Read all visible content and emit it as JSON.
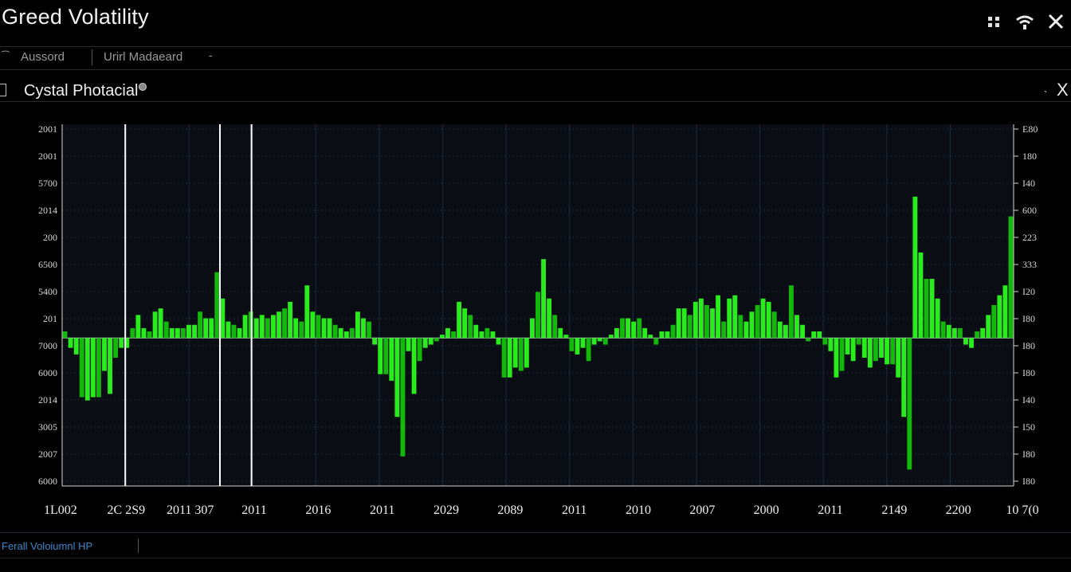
{
  "window": {
    "title": "Greed Volatility",
    "controls": [
      "grid-icon",
      "wifi-icon",
      "close-icon"
    ]
  },
  "tabs": {
    "items": [
      {
        "label": "Aussord"
      },
      {
        "label": "Urirl Madaeard"
      }
    ]
  },
  "panel": {
    "title": "Cystal Photacial"
  },
  "status": {
    "text": "Ferall Voloiumnl HP"
  },
  "colors": {
    "background": "#000000",
    "plot_bg": "#0a0d14",
    "bar": "#2aeb1e",
    "bar_dark": "#14b80c",
    "axis": "#d8d8d8",
    "grid": "#1d2a3a",
    "marker": "#ffffff",
    "status_text": "#3d86c8"
  },
  "chart_data": {
    "type": "bar",
    "title": "",
    "xlabel": "",
    "ylabel": "",
    "baseline": 0,
    "ylim": [
      -4.5,
      6.5
    ],
    "grid": true,
    "y_left_ticks": [
      "2001",
      "2001",
      "5700",
      "2014",
      "200",
      "6500",
      "5400",
      "201",
      "7000",
      "6000",
      "2014",
      "3005",
      "2007",
      "6000"
    ],
    "y_right_ticks": [
      "E80",
      "180",
      "I40",
      "600",
      "223",
      "333",
      "I20",
      "I80",
      "I80",
      "I80",
      "I40",
      "I50",
      "I80",
      "I80"
    ],
    "x_ticks": [
      "1L002",
      "2C 2S9",
      "2011 307",
      "2011",
      "2016",
      "2011",
      "2029",
      "2089",
      "2011",
      "2010",
      "2007",
      "2000",
      "2011",
      "2149",
      "2200",
      "10 7(0"
    ],
    "markers": [
      1,
      2.5,
      3
    ],
    "values": [
      0.2,
      -0.3,
      -0.5,
      -1.8,
      -1.9,
      -1.8,
      -1.8,
      -1.0,
      -1.7,
      -0.6,
      -0.3,
      -0.3,
      0.3,
      0.7,
      0.3,
      0.2,
      0.8,
      0.9,
      0.5,
      0.3,
      0.3,
      0.3,
      0.4,
      0.4,
      0.8,
      0.6,
      0.6,
      2.0,
      1.2,
      0.5,
      0.4,
      0.3,
      0.7,
      0.8,
      0.6,
      0.7,
      0.6,
      0.7,
      0.8,
      0.9,
      1.1,
      0.6,
      0.5,
      1.6,
      0.8,
      0.7,
      0.6,
      0.6,
      0.4,
      0.3,
      0.2,
      0.3,
      0.8,
      0.6,
      0.5,
      -0.2,
      -1.1,
      -1.1,
      -1.3,
      -2.4,
      -3.6,
      -0.4,
      -1.7,
      -0.7,
      -0.3,
      -0.2,
      -0.1,
      0.1,
      0.3,
      0.2,
      1.1,
      0.9,
      0.7,
      0.4,
      0.2,
      0.3,
      0.2,
      -0.2,
      -1.2,
      -1.2,
      -0.9,
      -1.0,
      -0.9,
      0.6,
      1.4,
      2.4,
      1.2,
      0.7,
      0.3,
      0.1,
      -0.4,
      -0.5,
      -0.3,
      -0.7,
      -0.2,
      -0.1,
      -0.2,
      0.1,
      0.3,
      0.6,
      0.6,
      0.5,
      0.6,
      0.3,
      0.1,
      -0.2,
      0.2,
      0.2,
      0.4,
      0.9,
      0.9,
      0.7,
      1.1,
      1.2,
      1.0,
      0.9,
      1.3,
      0.5,
      1.2,
      1.3,
      0.7,
      0.5,
      0.8,
      1.0,
      1.2,
      1.1,
      0.8,
      0.5,
      0.4,
      1.6,
      0.7,
      0.4,
      -0.1,
      0.2,
      0.2,
      -0.2,
      -0.4,
      -1.2,
      -1.0,
      -0.5,
      -0.7,
      -0.2,
      -0.6,
      -0.9,
      -0.7,
      -0.6,
      -0.8,
      -0.8,
      -1.2,
      -2.4,
      -4.0,
      4.3,
      2.6,
      1.8,
      1.8,
      1.2,
      0.5,
      0.4,
      0.3,
      0.3,
      -0.2,
      -0.3,
      0.2,
      0.3,
      0.7,
      1.0,
      1.3,
      1.6,
      3.7
    ]
  }
}
